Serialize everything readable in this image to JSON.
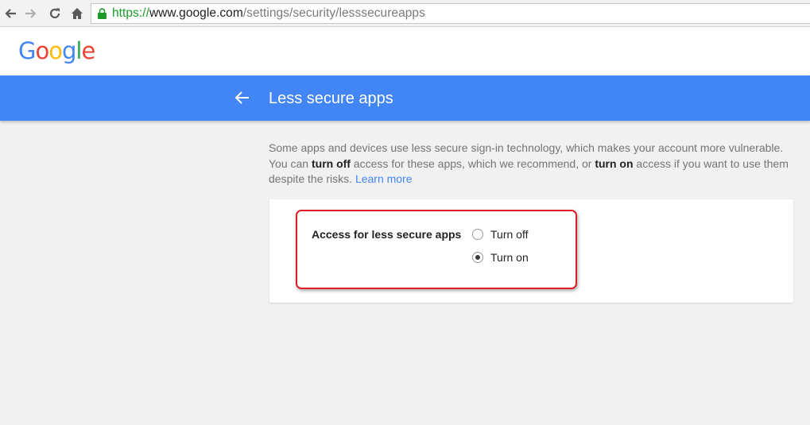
{
  "browser": {
    "url_protocol": "https://",
    "url_host": "www.google.com",
    "url_path": "/settings/security/lesssecureapps"
  },
  "header": {
    "logo_letters": [
      "G",
      "o",
      "o",
      "g",
      "l",
      "e"
    ]
  },
  "titlebar": {
    "title": "Less secure apps",
    "color": "#4285f4"
  },
  "description": {
    "part1": "Some apps and devices use less secure sign-in technology, which makes your account more vulnerable. You can ",
    "bold1": "turn off",
    "part2": " access for these apps, which we recommend, or ",
    "bold2": "turn on",
    "part3": " access if you want to use them despite the risks. ",
    "link": "Learn more"
  },
  "setting": {
    "label": "Access for less secure apps",
    "options": [
      {
        "label": "Turn off",
        "checked": false
      },
      {
        "label": "Turn on",
        "checked": true
      }
    ],
    "highlight_color": "#e01e25"
  }
}
